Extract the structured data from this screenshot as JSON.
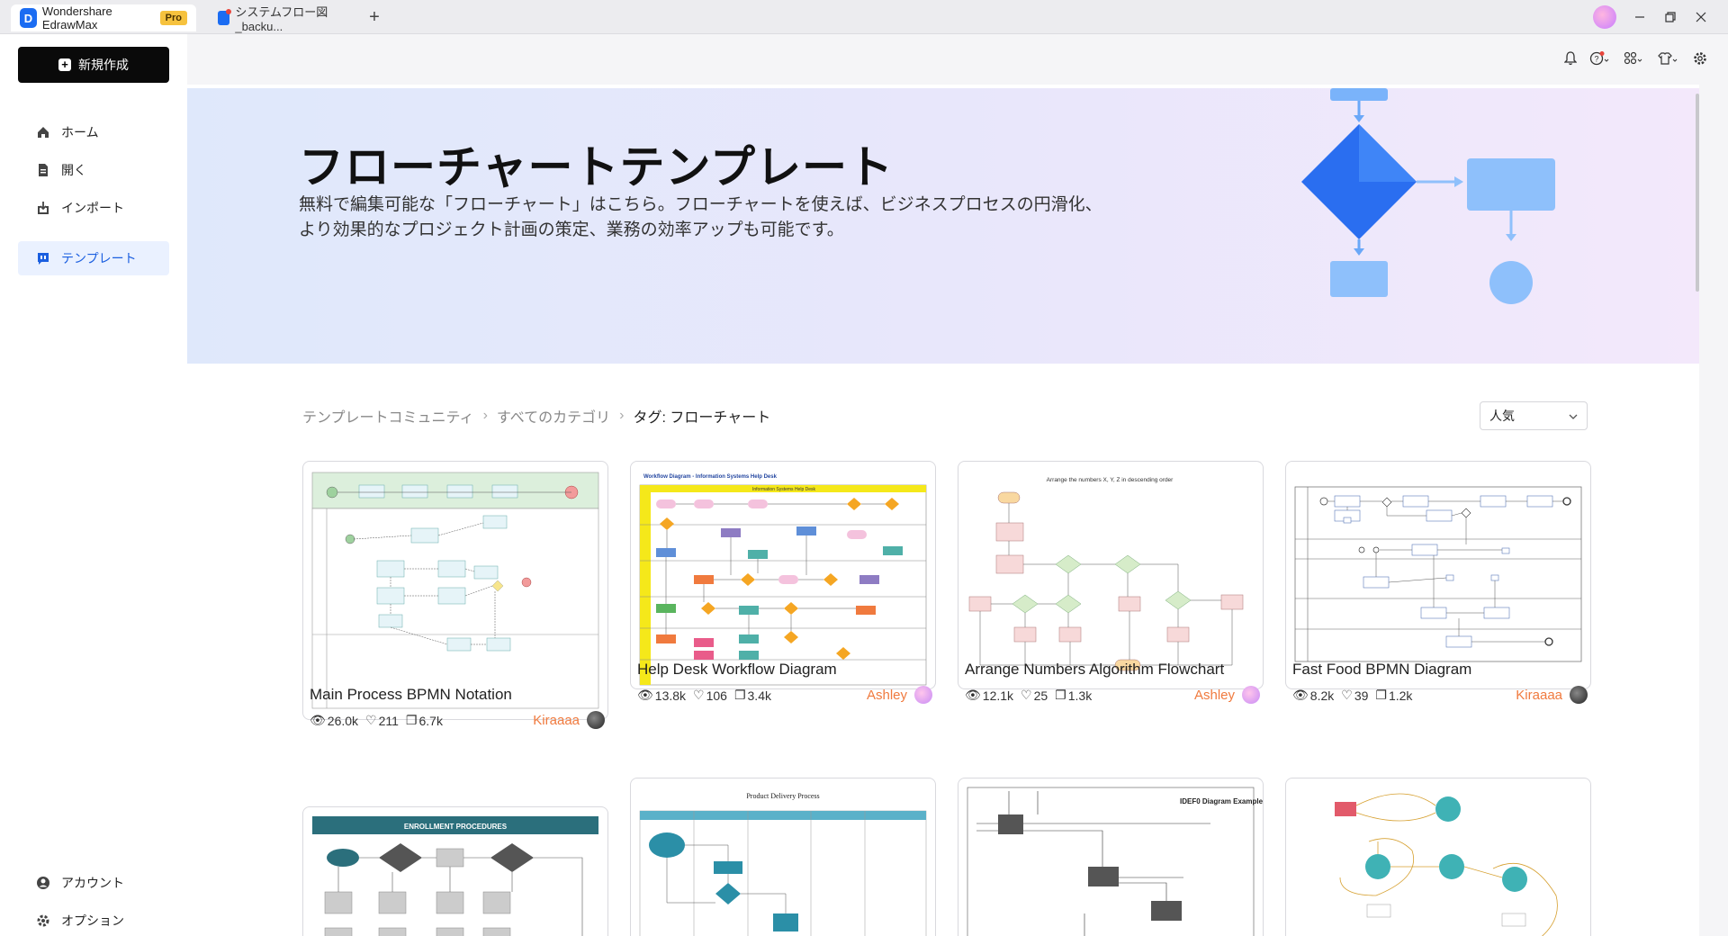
{
  "titlebar": {
    "app_title": "Wondershare EdrawMax",
    "pro_badge": "Pro",
    "doc_tab": "システムフロー図_backu...",
    "add_tab": "+"
  },
  "sidebar": {
    "new_button": "新規作成",
    "items": [
      {
        "label": "ホーム",
        "icon": "home-icon"
      },
      {
        "label": "開く",
        "icon": "file-icon"
      },
      {
        "label": "インポート",
        "icon": "import-icon"
      },
      {
        "label": "テンプレート",
        "icon": "template-icon"
      }
    ],
    "bottom_items": [
      {
        "label": "アカウント",
        "icon": "account-icon"
      },
      {
        "label": "オプション",
        "icon": "settings-icon"
      }
    ]
  },
  "hero": {
    "title": "フローチャートテンプレート",
    "desc_line1": "無料で編集可能な「フローチャート」はこちら。フローチャートを使えば、ビジネスプロセスの円滑化、",
    "desc_line2": "より効果的なプロジェクト計画の策定、業務の効率アップも可能です。"
  },
  "breadcrumb": {
    "level1": "テンプレートコミュニティ",
    "level2": "すべてのカテゴリ",
    "current": "タグ: フローチャート"
  },
  "sort": {
    "selected": "人気"
  },
  "cards": [
    {
      "title": "Main Process BPMN Notation",
      "views": "26.0k",
      "likes": "211",
      "copies": "6.7k",
      "author": "Kiraaaa"
    },
    {
      "title": "Help Desk Workflow Diagram",
      "views": "13.8k",
      "likes": "106",
      "copies": "3.4k",
      "author": "Ashley"
    },
    {
      "title": "Arrange Numbers Algorithm Flowchart",
      "views": "12.1k",
      "likes": "25",
      "copies": "1.3k",
      "author": "Ashley"
    },
    {
      "title": "Fast Food BPMN Diagram",
      "views": "8.2k",
      "likes": "39",
      "copies": "1.2k",
      "author": "Kiraaaa"
    }
  ],
  "thumbs": {
    "help_desk_header": "Workflow Diagram - Information Systems Help Desk",
    "help_desk_sub": "Information Systems Help Desk",
    "arrange_header": "Arrange the numbers X, Y, Z in descending order",
    "enrollment_header": "ENROLLMENT PROCEDURES",
    "product_header": "Product Delivery Process",
    "idef0_header": "IDEF0 Diagram Example"
  },
  "colors": {
    "accent": "#1b5fe0",
    "author": "#f07a3e",
    "new_button": "#0a0a0a",
    "pro_badge": "#f6c23e"
  }
}
